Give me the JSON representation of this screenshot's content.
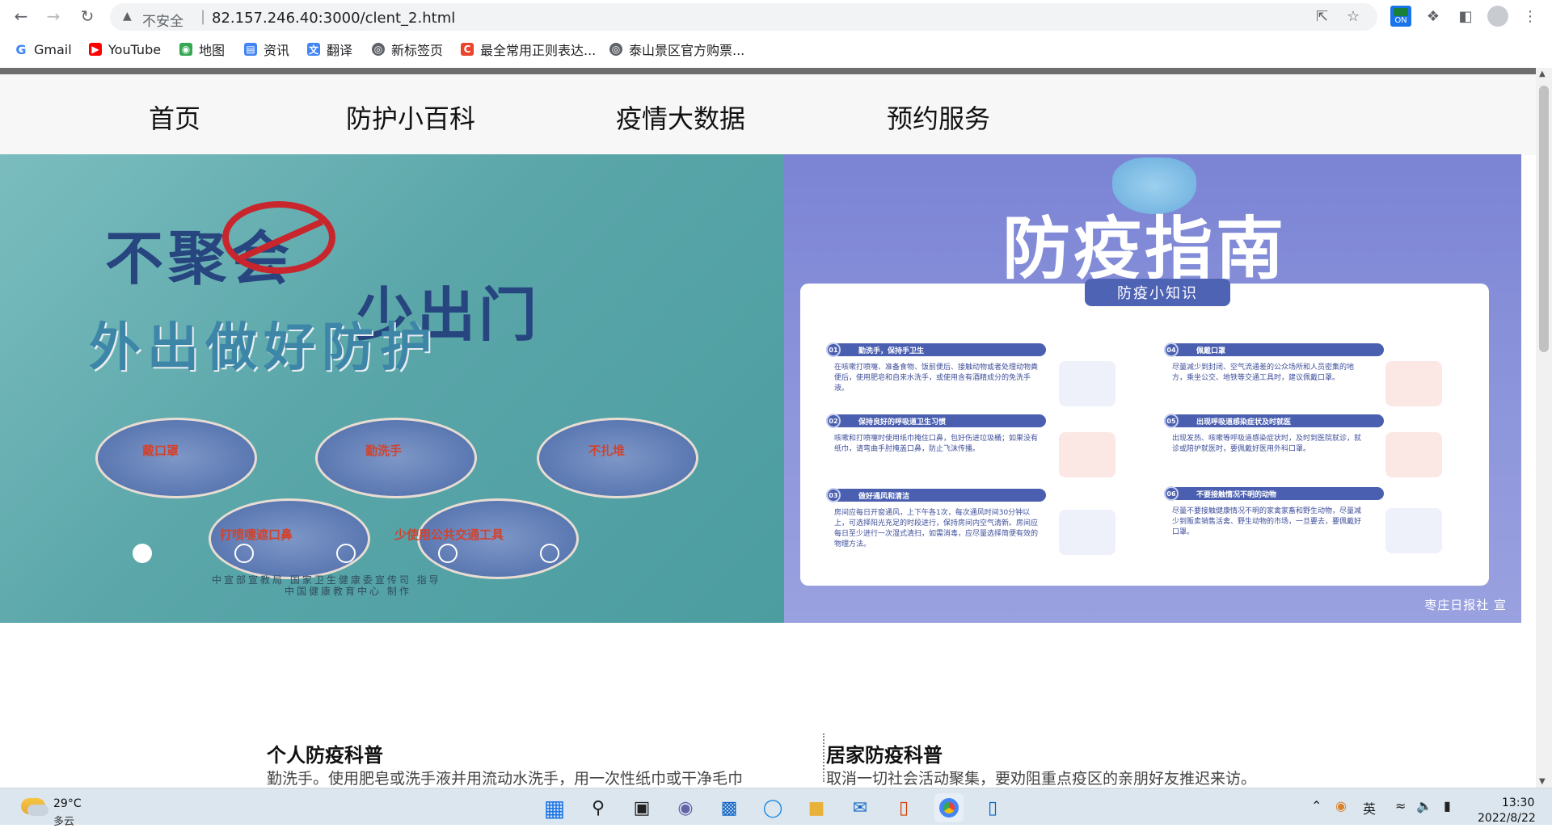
{
  "browser": {
    "security_label": "不安全",
    "url": "82.157.246.40:3000/clent_2.html",
    "bookmarks": [
      {
        "label": "Gmail",
        "icon": "gmail-icon",
        "color": "#4285f4"
      },
      {
        "label": "YouTube",
        "icon": "youtube-icon",
        "color": "#ff0000"
      },
      {
        "label": "地图",
        "icon": "maps-icon",
        "color": "#34a853"
      },
      {
        "label": "资讯",
        "icon": "news-icon",
        "color": "#4285f4"
      },
      {
        "label": "翻译",
        "icon": "translate-icon",
        "color": "#4285f4"
      },
      {
        "label": "新标签页",
        "icon": "globe-icon",
        "color": "#5f6368"
      },
      {
        "label": "最全常用正则表达...",
        "icon": "csdn-icon",
        "color": "#e8452c"
      },
      {
        "label": "泰山景区官方购票...",
        "icon": "globe-icon",
        "color": "#5f6368"
      }
    ],
    "extension_badge": "ON"
  },
  "nav": {
    "items": [
      "首页",
      "防护小百科",
      "疫情大数据",
      "预约服务"
    ]
  },
  "banner": {
    "left_slide": {
      "line1": "不聚会",
      "line2": "少出门",
      "line3": "外出做好防护",
      "items": [
        "戴口罩",
        "勤洗手",
        "不扎堆",
        "打喷嚏遮口鼻",
        "少使用公共交通工具"
      ],
      "credit1": "中宣部宣教局  国家卫生健康委宣传司  指导",
      "credit2": "中国健康教育中心  制作"
    },
    "dots": {
      "count": 5,
      "active_index": 0
    },
    "right_slide": {
      "title": "防疫指南",
      "pill": "防疫小知识",
      "tips": [
        {
          "num": "01",
          "head": "勤洗手，保持手卫生",
          "body": "在咳嗽打喷嚏、准备食物、饭前便后、接触动物或者处理动物粪便后，使用肥皂和自来水洗手，或使用含有酒精成分的免洗手液。"
        },
        {
          "num": "02",
          "head": "保持良好的呼吸道卫生习惯",
          "body": "咳嗽和打喷嚏时使用纸巾掩住口鼻，包好伤进垃圾桶；如果没有纸巾，请弯曲手肘掩盖口鼻，防止飞沫传播。"
        },
        {
          "num": "03",
          "head": "做好通风和清洁",
          "body": "房间应每日开窗通风，上下午各1次，每次通风时间30分钟以上，可选择阳光充足的时段进行，保持房间内空气清新。房间应每日至少进行一次湿式清扫，如需消毒，应尽量选择简便有效的物理方法。"
        },
        {
          "num": "04",
          "head": "佩戴口罩",
          "body": "尽量减少到封闭、空气流通差的公众场所和人员密集的地方，乘坐公交、地铁等交通工具时，建议佩戴口罩。"
        },
        {
          "num": "05",
          "head": "出现呼吸道感染症状及时就医",
          "body": "出现发热、咳嗽等呼吸道感染症状时，及时到医院就诊，就诊或陪护就医时，要佩戴好医用外科口罩。"
        },
        {
          "num": "06",
          "head": "不要接触情况不明的动物",
          "body": "尽量不要接触健康情况不明的家禽家畜和野生动物，尽量减少到贩卖销售活禽、野生动物的市场，一旦要去，要佩戴好口罩。"
        }
      ],
      "brand": "枣庄日报社  宣"
    }
  },
  "sections": [
    {
      "title": "个人防疫科普",
      "text": "勤洗手。使用肥皂或洗手液并用流动水洗手，用一次性纸巾或干净毛巾"
    },
    {
      "title": "居家防疫科普",
      "text": "取消一切社会活动聚集，要劝阻重点疫区的亲朋好友推迟来访。"
    }
  ],
  "taskbar": {
    "weather_temp": "29°C",
    "weather_desc": "多云",
    "ime": "英",
    "time": "13:30",
    "date": "2022/8/22",
    "apps": [
      "windows-start-icon",
      "search-icon",
      "task-view-icon",
      "chat-icon",
      "store-icon",
      "edge-icon",
      "explorer-icon",
      "mail-icon",
      "office-icon",
      "chrome-icon",
      "phone-link-icon"
    ]
  }
}
